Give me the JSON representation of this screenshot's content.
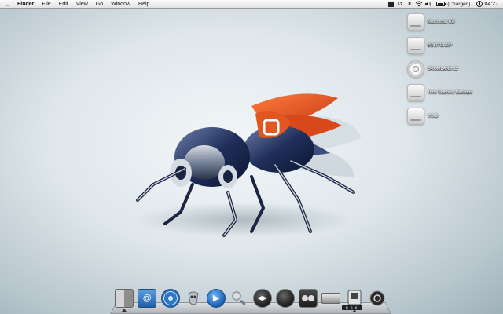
{
  "menubar": {
    "apple_icon": "apple-icon",
    "app_name": "Finder",
    "menus": [
      "File",
      "Edit",
      "View",
      "Go",
      "Window",
      "Help"
    ],
    "status_icons": [
      "display-icon",
      "time-machine-icon",
      "bluetooth-icon",
      "wifi-icon",
      "volume-icon",
      "battery-icon"
    ],
    "battery_status": "(Charged)",
    "battery_level": 1.0,
    "clock": "04:27"
  },
  "desktop_icons": [
    {
      "label": "Macintosh HD",
      "icon": "hard-drive-icon"
    },
    {
      "label": "BOOTCAMP",
      "icon": "hard-drive-icon"
    },
    {
      "label": "DRUMLAND 12",
      "icon": "disc-icon"
    },
    {
      "label": "Time Machine Backups",
      "icon": "hard-drive-icon"
    },
    {
      "label": "VOID",
      "icon": "hard-drive-icon"
    }
  ],
  "dock": {
    "items": [
      {
        "name": "finder",
        "icon": "finder-icon"
      },
      {
        "name": "mail",
        "icon": "mail-icon"
      },
      {
        "name": "safari",
        "icon": "safari-icon"
      },
      {
        "name": "transmission",
        "icon": "transmission-icon"
      },
      {
        "name": "ichat",
        "icon": "video-chat-icon"
      },
      {
        "name": "spotlight",
        "icon": "magnifier-icon"
      },
      {
        "name": "media-player",
        "icon": "media-player-icon"
      },
      {
        "name": "dvd-player",
        "icon": "dvd-icon"
      },
      {
        "name": "game-controller",
        "icon": "gamepad-icon"
      },
      {
        "name": "drive-utility",
        "icon": "drive-icon"
      },
      {
        "name": "desktop-folder",
        "icon": "disk-folder-icon",
        "badge": "D S K"
      },
      {
        "name": "trash",
        "icon": "trash-icon"
      }
    ]
  },
  "colors": {
    "wallpaper_center": "#f2f6f8",
    "wallpaper_edge": "#9fb1ba",
    "fly_orange": "#e2561f",
    "fly_navy": "#1f2f5a"
  }
}
